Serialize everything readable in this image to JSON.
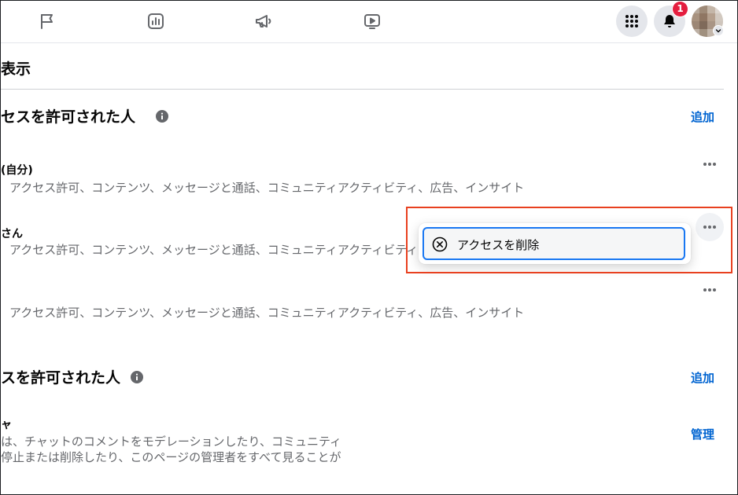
{
  "topbar": {
    "icons": [
      "flag-icon",
      "insights-icon",
      "megaphone-icon",
      "video-icon"
    ],
    "notification_count": "1"
  },
  "page": {
    "title": "表示",
    "section1": {
      "title": "セスを許可された人",
      "add_label": "追加",
      "members": [
        {
          "name": "(自分)",
          "permissions": "アクセス許可、コンテンツ、メッセージと通話、コミュニティアクティビティ、広告、インサイト"
        },
        {
          "name": "さん",
          "permissions": "アクセス許可、コンテンツ、メッセージと通話、コミュニティアクティビティ、"
        },
        {
          "name": "",
          "permissions": "アクセス許可、コンテンツ、メッセージと通話、コミュニティアクティビティ、広告、インサイト"
        }
      ]
    },
    "section2": {
      "title": "スを許可された人",
      "add_label": "追加",
      "role": {
        "name": "ャ",
        "desc_line1": "は、チャットのコメントをモデレーションしたり、コミュニティ",
        "desc_line2": "停止または削除したり、このページの管理者をすべて見ることが",
        "manage_label": "管理"
      }
    }
  },
  "dropdown": {
    "remove_access_label": "アクセスを削除"
  }
}
